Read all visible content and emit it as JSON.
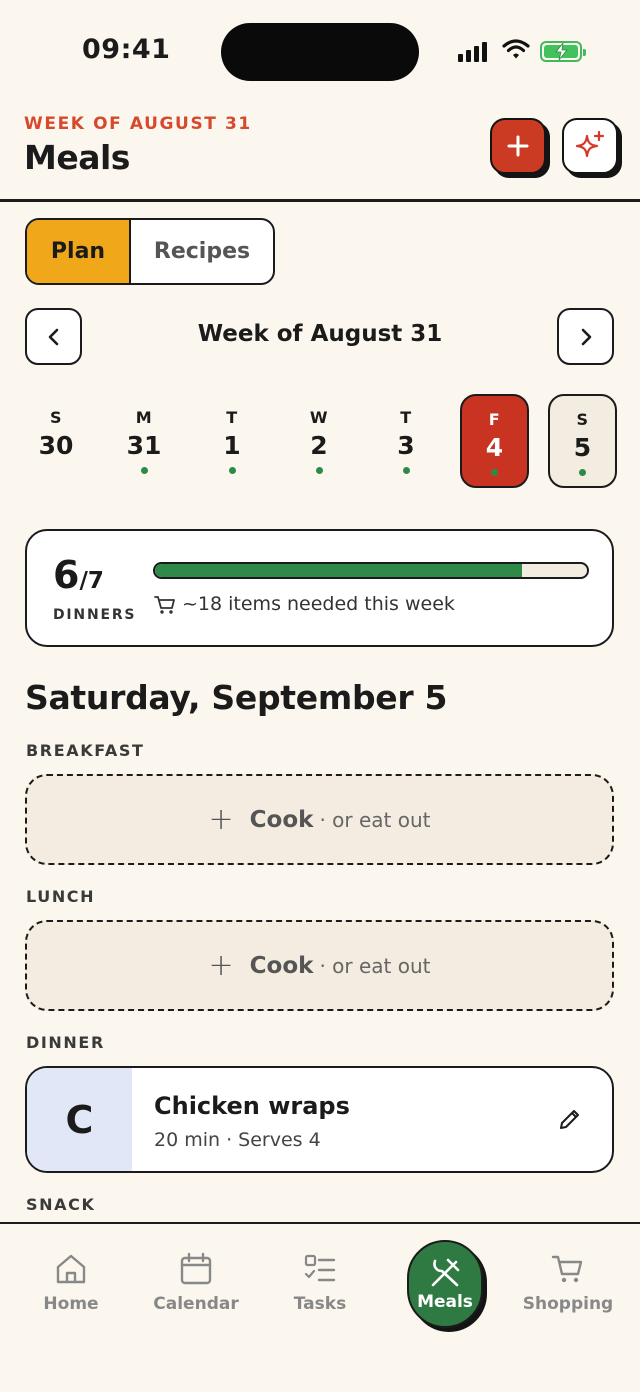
{
  "status": {
    "time": "09:41"
  },
  "header": {
    "kicker": "WEEK OF AUGUST 31",
    "title": "Meals",
    "add_icon": "plus-icon",
    "magic_icon": "sparkles-icon"
  },
  "segment": {
    "plan": "Plan",
    "recipes": "Recipes",
    "selected": "Plan"
  },
  "week_nav": {
    "label": "Week of August 31"
  },
  "days": [
    {
      "letter": "S",
      "num": "30",
      "has_dot": false
    },
    {
      "letter": "M",
      "num": "31",
      "has_dot": true
    },
    {
      "letter": "T",
      "num": "1",
      "has_dot": true
    },
    {
      "letter": "W",
      "num": "2",
      "has_dot": true
    },
    {
      "letter": "T",
      "num": "3",
      "has_dot": true
    },
    {
      "letter": "F",
      "num": "4",
      "has_dot": true
    },
    {
      "letter": "S",
      "num": "5",
      "has_dot": true
    }
  ],
  "summary": {
    "done": "6",
    "total": "/7",
    "label": "DINNERS",
    "progress": 0.85,
    "items": "~18 items needed this week"
  },
  "day_heading": "Saturday, September 5",
  "meals": {
    "breakfast_label": "BREAKFAST",
    "lunch_label": "LUNCH",
    "dinner_label": "DINNER",
    "snack_label": "SNACK",
    "empty_cook": "Cook",
    "empty_alt": "· or eat out",
    "dinner": {
      "initial": "C",
      "name": "Chicken wraps",
      "meta": "20 min · Serves 4"
    }
  },
  "tabs": {
    "home": "Home",
    "calendar": "Calendar",
    "tasks": "Tasks",
    "meals": "Meals",
    "shopping": "Shopping"
  },
  "colors": {
    "accent_red": "#cb3a22",
    "accent_yellow": "#f0a81a",
    "accent_green": "#2e7a42",
    "background": "#fbf6ee"
  }
}
